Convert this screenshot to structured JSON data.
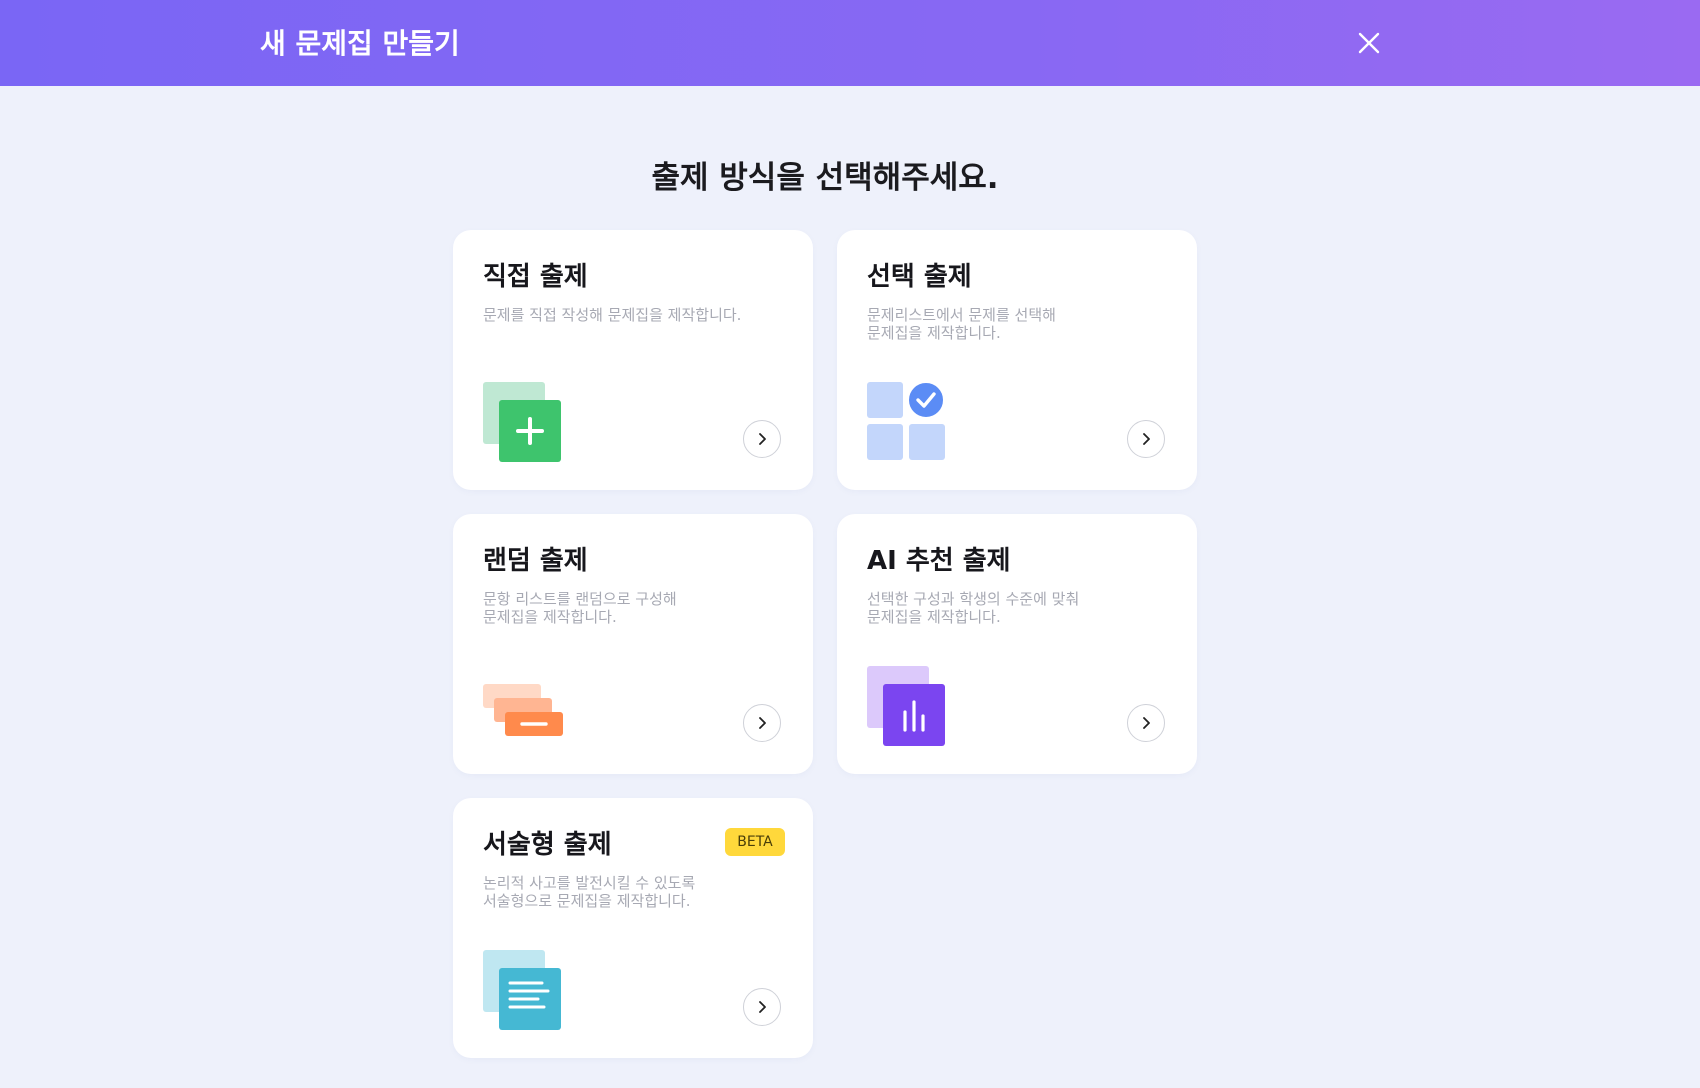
{
  "header": {
    "title": "새 문제집 만들기",
    "close_icon": "close-icon"
  },
  "main": {
    "heading": "출제 방식을 선택해주세요."
  },
  "cards": [
    {
      "title": "직접 출제",
      "description": "문제를 직접 작성해 문제집을 제작합니다.",
      "icon": "add-document-icon"
    },
    {
      "title": "선택 출제",
      "description": "문제리스트에서 문제를 선택해\n문제집을 제작합니다.",
      "icon": "select-grid-icon"
    },
    {
      "title": "랜덤 출제",
      "description": "문항 리스트를 랜덤으로 구성해\n문제집을 제작합니다.",
      "icon": "stacked-cards-icon"
    },
    {
      "title": "AI 추천 출제",
      "description": "선택한 구성과 학생의 수준에 맞춰\n문제집을 제작합니다.",
      "icon": "bar-chart-icon"
    },
    {
      "title": "서술형 출제",
      "description": "논리적 사고를 발전시킬 수 있도록\n서술형으로 문제집을 제작합니다.",
      "icon": "text-document-icon",
      "badge": "BETA"
    }
  ],
  "colors": {
    "header_gradient_start": "#7a66f5",
    "header_gradient_end": "#9a6af2",
    "background": "#eef1fb",
    "green": "#3ec46d",
    "blue": "#5b8cf5",
    "orange": "#ff8a4c",
    "purple": "#7b45f0",
    "teal": "#45b8d3",
    "beta_badge": "#ffd83b"
  }
}
